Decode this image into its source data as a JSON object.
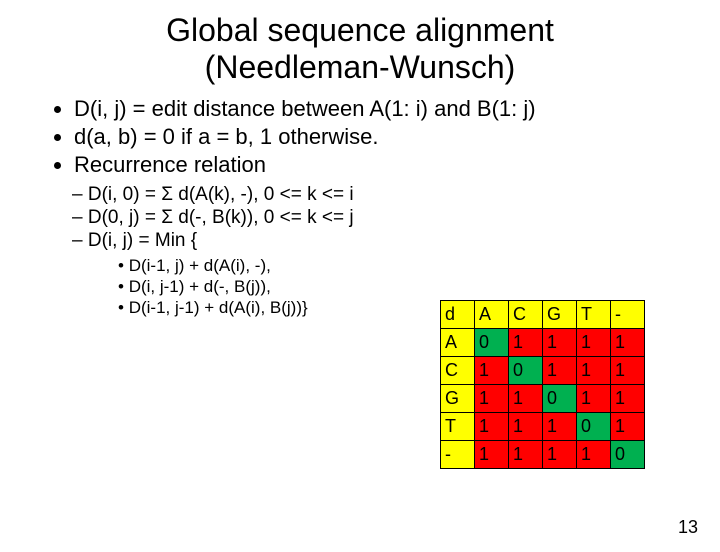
{
  "title_line1": "Global sequence alignment",
  "title_line2": "(Needleman-Wunsch)",
  "bullets": [
    "D(i, j) = edit distance between A(1: i) and B(1: j)",
    "d(a, b) = 0 if a = b, 1 otherwise.",
    "Recurrence relation"
  ],
  "subbullets": [
    "D(i, 0) = Σ d(A(k), -), 0 <= k <= i",
    "D(0, j) = Σ d(-, B(k)), 0 <= k <= j",
    "D(i, j) = Min {"
  ],
  "subsubbullets": [
    "D(i-1, j) + d(A(i), -),",
    "D(i, j-1) + d(-, B(j)),",
    "D(i-1, j-1) + d(A(i), B(j))}"
  ],
  "chart_data": {
    "type": "table",
    "col_headers": [
      "d",
      "A",
      "C",
      "G",
      "T",
      "-"
    ],
    "row_headers": [
      "A",
      "C",
      "G",
      "T",
      "-"
    ],
    "values": [
      [
        0,
        1,
        1,
        1,
        1
      ],
      [
        1,
        0,
        1,
        1,
        1
      ],
      [
        1,
        1,
        0,
        1,
        1
      ],
      [
        1,
        1,
        1,
        0,
        1
      ],
      [
        1,
        1,
        1,
        1,
        0
      ]
    ]
  },
  "page_number": "13"
}
